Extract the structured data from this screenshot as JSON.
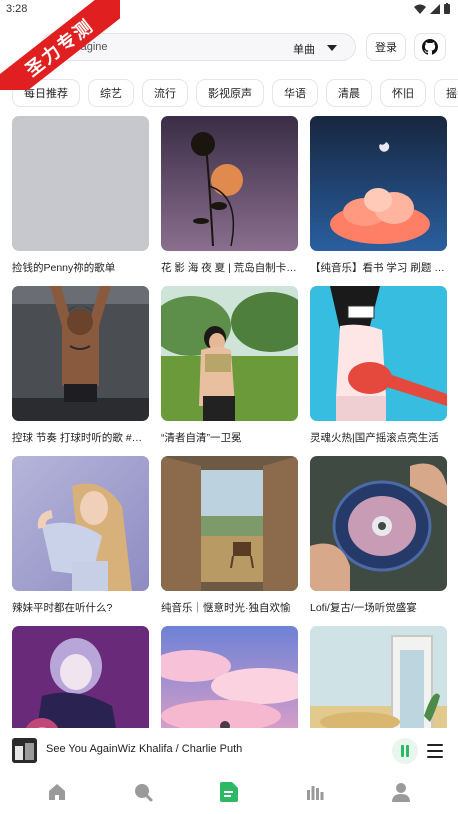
{
  "status_bar": {
    "time": "3:28"
  },
  "watermark": {
    "text": "圣力专测"
  },
  "search": {
    "query": "You agine",
    "type_label": "单曲"
  },
  "header": {
    "login_label": "登录",
    "github_icon": "github-icon"
  },
  "tags": [
    "每日推荐",
    "综艺",
    "流行",
    "影视原声",
    "华语",
    "清晨",
    "怀旧",
    "摇滚"
  ],
  "playlists": [
    {
      "title": "捡钱的Penny祢的歌单",
      "cover": "blank"
    },
    {
      "title": "花 影 海 夜 夏 | 荒岛自制卡带音乐",
      "cover": "sunflower-moon"
    },
    {
      "title": "【纯音乐】看书 学习 刷题 专注",
      "cover": "pink-cloud"
    },
    {
      "title": "控球 节奏 打球时听的歌 #篮球",
      "cover": "athlete"
    },
    {
      "title": "“清者自清”一卫冕",
      "cover": "girl-field"
    },
    {
      "title": "灵魂火热|国产摇滚点亮生活",
      "cover": "anime-guitar"
    },
    {
      "title": "辣妹平时都在听什么?",
      "cover": "singer-portrait"
    },
    {
      "title": "纯音乐｜惬意时光·独自欢愉",
      "cover": "window-view"
    },
    {
      "title": "Lofi/复古/一场听觉盛宴",
      "cover": "record-disc"
    },
    {
      "title": "",
      "cover": "purple-anime"
    },
    {
      "title": "",
      "cover": "pink-sky"
    },
    {
      "title": "",
      "cover": "desert-door"
    }
  ],
  "player": {
    "track": "See You AgainWiz Khalifa / Charlie Puth",
    "state": "playing"
  },
  "nav": [
    {
      "name": "home-icon"
    },
    {
      "name": "search-icon"
    },
    {
      "name": "playlist-icon",
      "active": true
    },
    {
      "name": "charts-icon"
    },
    {
      "name": "user-icon"
    }
  ],
  "colors": {
    "accent": "#2fb864",
    "tag_border": "#e6e6e6",
    "nav_inactive": "#9a9a9a",
    "ribbon": "#e02020"
  }
}
